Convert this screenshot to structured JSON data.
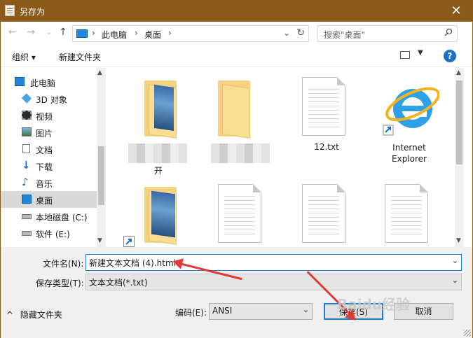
{
  "window": {
    "title": "另存为",
    "close": "✕"
  },
  "navbar": {
    "back": "←",
    "forward": "→",
    "recent": "⌄",
    "up": "↑",
    "path": [
      "此电脑",
      "桌面"
    ],
    "dropdown": "⌄",
    "refresh": "↻",
    "search_placeholder": "搜索\"桌面\""
  },
  "toolbar": {
    "organize": "组织 ▾",
    "new_folder": "新建文件夹",
    "help": "?"
  },
  "sidebar": {
    "items": [
      {
        "label": "此电脑",
        "icon": "computer-icon"
      },
      {
        "label": "3D 对象",
        "icon": "cube-icon"
      },
      {
        "label": "视频",
        "icon": "film-icon"
      },
      {
        "label": "图片",
        "icon": "picture-icon"
      },
      {
        "label": "文档",
        "icon": "document-icon"
      },
      {
        "label": "下载",
        "icon": "download-icon"
      },
      {
        "label": "音乐",
        "icon": "music-icon"
      },
      {
        "label": "桌面",
        "icon": "desktop-icon",
        "selected": true
      },
      {
        "label": "本地磁盘 (C:)",
        "icon": "drive-icon"
      },
      {
        "label": "软件 (E:)",
        "icon": "drive-icon"
      }
    ]
  },
  "files": [
    {
      "type": "folder",
      "caption": "开"
    },
    {
      "type": "folder",
      "caption": ""
    },
    {
      "type": "text",
      "caption": "12.txt"
    },
    {
      "type": "shortcut",
      "caption": "Internet\nExplorer"
    },
    {
      "type": "folder-shortcut",
      "caption": ""
    },
    {
      "type": "text",
      "caption": ""
    },
    {
      "type": "text",
      "caption": ""
    },
    {
      "type": "text",
      "caption": ""
    }
  ],
  "form": {
    "filename_label": "文件名(N):",
    "filename_value": "新建文本文档 (4).html",
    "filetype_label": "保存类型(T):",
    "filetype_value": "文本文档(*.txt)",
    "encoding_label": "编码(E):",
    "encoding_value": "ANSI",
    "save_label": "保存(S)",
    "cancel_label": "取消",
    "hide_folders_label": "隐藏文件夹"
  },
  "colors": {
    "titlebar": "#8a5a1a",
    "accent": "#1c7ccf",
    "annotation": "#e53935"
  },
  "watermark": "Baidu经验"
}
